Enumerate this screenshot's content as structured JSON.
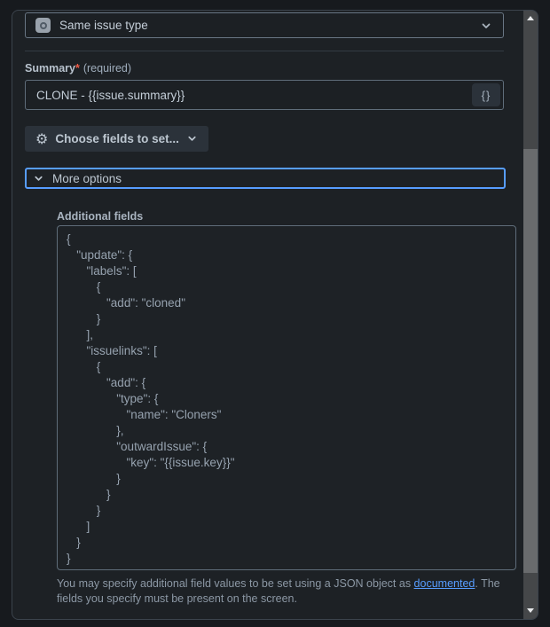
{
  "issue_type_select": {
    "label": "Same issue type"
  },
  "summary": {
    "label": "Summary",
    "asterisk": "*",
    "required_hint": "(required)",
    "value": "CLONE - {{issue.summary}}",
    "braces_button": "{}"
  },
  "choose_fields_button": {
    "label": "Choose fields to set...",
    "gear_glyph": "⚙"
  },
  "more_options": {
    "label": "More options"
  },
  "additional_fields": {
    "label": "Additional fields",
    "code_lines": [
      "{",
      "   \"update\": {",
      "      \"labels\": [",
      "         {",
      "            \"add\": \"cloned\"",
      "         }",
      "      ],",
      "      \"issuelinks\": [",
      "         {",
      "            \"add\": {",
      "               \"type\": {",
      "                  \"name\": \"Cloners\"",
      "               },",
      "               \"outwardIssue\": {",
      "                  \"key\": \"{{issue.key}}\"",
      "               }",
      "            }",
      "         }",
      "      ]",
      "   }",
      "}"
    ],
    "help": {
      "before": "You may specify additional field values to be set using a JSON object as ",
      "link": "documented",
      "after": ". The fields you specify must be present on the screen."
    }
  },
  "colors": {
    "focus_ring": "#579dff",
    "link": "#579dff",
    "required_asterisk": "#ef5c48",
    "panel_bg": "#1d2125",
    "page_bg": "#171a1e"
  }
}
